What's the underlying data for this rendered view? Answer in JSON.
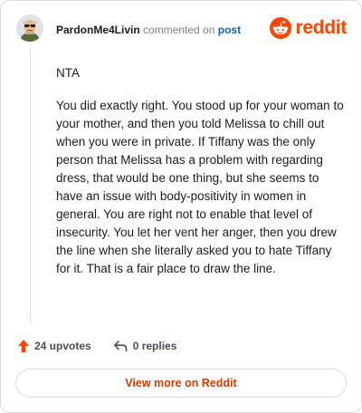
{
  "comment": {
    "author": "PardonMe4Livin",
    "action_text": "commented on",
    "post_link": "post",
    "paragraphs": [
      "NTA",
      "You did exactly right. You stood up for your woman to your mother, and then you told Melissa to chill out when you were in private. If Tiffany was the only person that Melissa has a problem with regarding dress, that would be one thing, but she seems to have an issue with body-positivity in women in general. You are right not to enable that level of insecurity. You let her vent her anger, then you drew the line when she literally asked you to hate Tiffany for it. That is a fair place to draw the line."
    ]
  },
  "brand": {
    "name": "reddit",
    "color": "#ff4500",
    "icon": "reddit-snoo-icon"
  },
  "actions": {
    "upvotes_label": "24 upvotes",
    "replies_label": "0 replies",
    "upvote_icon": "upvote-arrow-icon",
    "reply_icon": "reply-arrow-icon"
  },
  "cta": {
    "label": "View more on Reddit",
    "color": "#d93a00"
  },
  "colors": {
    "upvote": "#ff4500",
    "link": "#0b64c5"
  }
}
